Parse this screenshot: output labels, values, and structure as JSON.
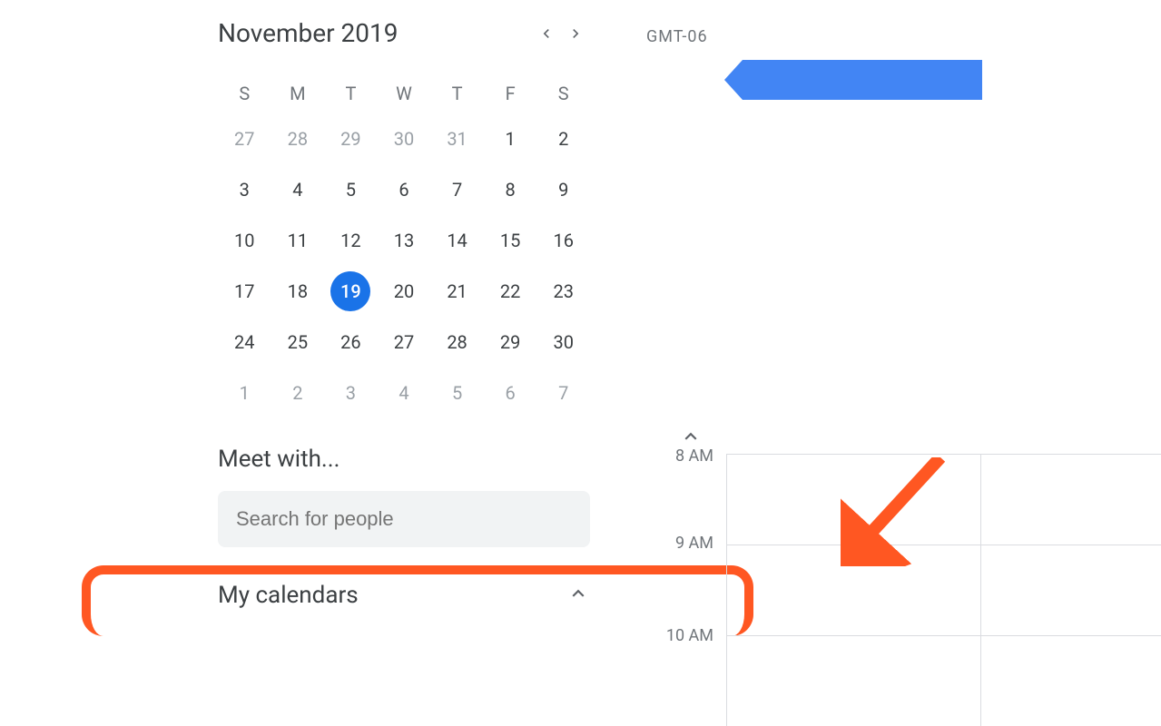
{
  "miniCal": {
    "title": "November 2019",
    "weekdays": [
      "S",
      "M",
      "T",
      "W",
      "T",
      "F",
      "S"
    ],
    "weeks": [
      [
        {
          "n": "27",
          "out": true
        },
        {
          "n": "28",
          "out": true
        },
        {
          "n": "29",
          "out": true
        },
        {
          "n": "30",
          "out": true
        },
        {
          "n": "31",
          "out": true
        },
        {
          "n": "1"
        },
        {
          "n": "2"
        }
      ],
      [
        {
          "n": "3"
        },
        {
          "n": "4"
        },
        {
          "n": "5"
        },
        {
          "n": "6"
        },
        {
          "n": "7"
        },
        {
          "n": "8"
        },
        {
          "n": "9"
        }
      ],
      [
        {
          "n": "10"
        },
        {
          "n": "11"
        },
        {
          "n": "12"
        },
        {
          "n": "13"
        },
        {
          "n": "14"
        },
        {
          "n": "15"
        },
        {
          "n": "16"
        }
      ],
      [
        {
          "n": "17"
        },
        {
          "n": "18"
        },
        {
          "n": "19",
          "selected": true
        },
        {
          "n": "20"
        },
        {
          "n": "21"
        },
        {
          "n": "22"
        },
        {
          "n": "23"
        }
      ],
      [
        {
          "n": "24"
        },
        {
          "n": "25"
        },
        {
          "n": "26"
        },
        {
          "n": "27"
        },
        {
          "n": "28"
        },
        {
          "n": "29"
        },
        {
          "n": "30"
        }
      ],
      [
        {
          "n": "1",
          "out": true
        },
        {
          "n": "2",
          "out": true
        },
        {
          "n": "3",
          "out": true
        },
        {
          "n": "4",
          "out": true
        },
        {
          "n": "5",
          "out": true
        },
        {
          "n": "6",
          "out": true
        },
        {
          "n": "7",
          "out": true
        }
      ]
    ]
  },
  "meetWith": {
    "title": "Meet with...",
    "placeholder": "Search for people"
  },
  "myCalendars": {
    "title": "My calendars"
  },
  "timezone": "GMT-06",
  "timeLabels": {
    "t8": "8 AM",
    "t9": "9 AM",
    "t10": "10 AM"
  },
  "colors": {
    "accent": "#1a73e8",
    "pointer": "#4285f4",
    "highlight": "#ff5722"
  }
}
